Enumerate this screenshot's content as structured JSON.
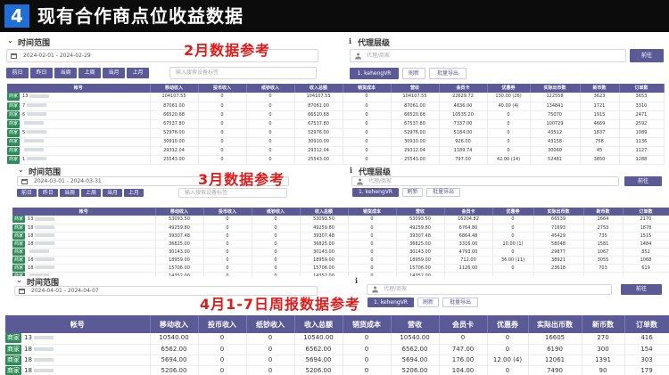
{
  "header": {
    "number": "4",
    "title": "现有合作商点位收益数据"
  },
  "common": {
    "time_range_label": "时间范围",
    "agent_level_label": "代理层级",
    "agent_placeholder": "代理/商家",
    "go_label": "前往",
    "search_placeholder": "输入搜索设备标签",
    "search_placeholder_short": "输入搜索设备标签",
    "agent_btn": "1. kehengVR",
    "refresh": "刷新",
    "export": "批量导出",
    "tag": "商家",
    "range_buttons": [
      "前日",
      "昨日",
      "当周",
      "上周",
      "当月",
      "上月"
    ],
    "columns": [
      "帐号",
      "移动收入",
      "投币收入",
      "纸钞收入",
      "收入总额",
      "销货成本",
      "营收",
      "会员卡",
      "优惠券",
      "实际出币数",
      "新币数",
      "订单数"
    ]
  },
  "feb": {
    "note": "2月数据参考",
    "date": "2024-02-01 - 2024-02-29",
    "rows": [
      [
        "13",
        "104107.55",
        "0",
        "0",
        "104107.55",
        "0",
        "104107.55",
        "22629.72",
        "130.00 (26)",
        "122558",
        "3623",
        "3653"
      ],
      [
        "7",
        "87061.00",
        "0",
        "0",
        "87061.00",
        "0",
        "87061.00",
        "4836.00",
        "40.00 (4)",
        "134841",
        "1721",
        "3310"
      ],
      [
        "6",
        "66520.68",
        "0",
        "0",
        "66520.68",
        "0",
        "66520.68",
        "10535.20",
        "0",
        "75070",
        "1915",
        "2471"
      ],
      [
        "",
        "67537.80",
        "0",
        "0",
        "67537.80",
        "0",
        "67537.80",
        "7337.00",
        "0",
        "100729",
        "4669",
        "2592"
      ],
      [
        "5",
        "52976.00",
        "0",
        "0",
        "52976.00",
        "0",
        "52976.00",
        "5184.00",
        "0",
        "43512",
        "1837",
        "1089"
      ],
      [
        "",
        "30910.00",
        "0",
        "0",
        "30910.00",
        "0",
        "30910.00",
        "926.00",
        "0",
        "43158",
        "758",
        "1136"
      ],
      [
        "",
        "29312.04",
        "0",
        "0",
        "29312.04",
        "0",
        "29312.04",
        "1189.74",
        "0",
        "30060",
        "45",
        "1127"
      ],
      [
        "1",
        "25543.00",
        "0",
        "0",
        "25543.00",
        "0",
        "25543.00",
        "797.00",
        "42.00 (14)",
        "52481",
        "3850",
        "1288"
      ]
    ]
  },
  "mar": {
    "note": "3月数据参考",
    "date": "2024-03-01 - 2024-03-31",
    "rows": [
      [
        "13",
        "53093.50",
        "0",
        "0",
        "53093.50",
        "0",
        "53093.50",
        "16204.82",
        "0",
        "66539",
        "1664",
        "2170"
      ],
      [
        "18",
        "49259.80",
        "0",
        "0",
        "49259.80",
        "0",
        "49259.80",
        "6764.80",
        "0",
        "71693",
        "2753",
        "1878"
      ],
      [
        "18",
        "39307.48",
        "0",
        "0",
        "39307.48",
        "0",
        "39307.48",
        "6864.48",
        "0",
        "45429",
        "735",
        "1515"
      ],
      [
        "18",
        "36825.00",
        "0",
        "0",
        "36825.00",
        "0",
        "36825.00",
        "3316.00",
        "10.00 (1)",
        "58048",
        "1581",
        "1484"
      ],
      [
        "",
        "30143.00",
        "0",
        "0",
        "30143.00",
        "0",
        "30143.00",
        "4793.00",
        "0",
        "29877",
        "1067",
        "852"
      ],
      [
        "18",
        "18959.00",
        "0",
        "0",
        "18959.00",
        "0",
        "18959.00",
        "712.00",
        "36.00 (11)",
        "38921",
        "3055",
        "1068"
      ],
      [
        "18",
        "15706.00",
        "0",
        "0",
        "15706.00",
        "0",
        "15706.00",
        "1126.00",
        "0",
        "23618",
        "703",
        "619"
      ],
      [
        "",
        "14352.00",
        "0",
        "0",
        "14352.00",
        "0",
        "14352.00",
        "",
        "",
        "",
        "",
        ""
      ]
    ],
    "name_tags": [
      "某店",
      "游戏机",
      "",
      "",
      "",
      "",
      "",
      "某商场"
    ]
  },
  "apr": {
    "note": "4月1-7日周报数据参考",
    "date": "2024-04-01 - 2024-04-07",
    "rows": [
      [
        "13",
        "10540.00",
        "0",
        "0",
        "10540.00",
        "0",
        "10540.00",
        "0",
        "0",
        "16605",
        "270",
        "416"
      ],
      [
        "18",
        "6562.00",
        "0",
        "0",
        "6562.00",
        "0",
        "6562.00",
        "747.00",
        "0",
        "6190",
        "300",
        "154"
      ],
      [
        "18",
        "5694.00",
        "0",
        "0",
        "5694.00",
        "0",
        "5694.00",
        "176.00",
        "12.00 (4)",
        "12061",
        "1391",
        "303"
      ],
      [
        "18",
        "5206.00",
        "0",
        "0",
        "5206.00",
        "0",
        "5206.00",
        "104.00",
        "0",
        "7490",
        "90",
        "179"
      ]
    ]
  },
  "colors": {
    "accent": "#5b5a97",
    "tag": "#2e8b57",
    "note": "#e01b1b",
    "header_bg": "#0c0c0c",
    "number_bg": "#1f6fd6"
  },
  "icons": [
    "calendar-icon",
    "chevron-down-icon",
    "info-icon",
    "person-icon",
    "sort-icon"
  ]
}
